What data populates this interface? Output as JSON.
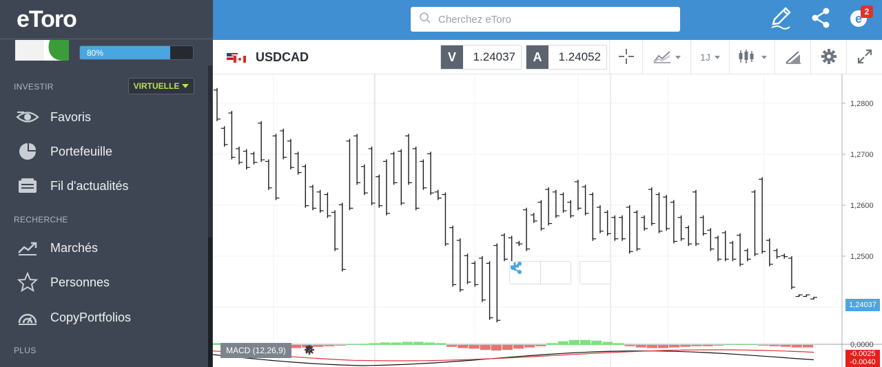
{
  "brand": {
    "logo_text": "eToro"
  },
  "profile": {
    "progress_label": "80%",
    "progress_value": 0.8
  },
  "sidebar": {
    "section_invest": "INVESTIR",
    "mode_label": "VIRTUELLE",
    "invest_items": [
      {
        "label": "Favoris",
        "icon": "eye-icon"
      },
      {
        "label": "Portefeuille",
        "icon": "pie-chart-icon"
      },
      {
        "label": "Fil d'actualités",
        "icon": "news-feed-icon"
      }
    ],
    "section_research": "RECHERCHE",
    "research_items": [
      {
        "label": "Marchés",
        "icon": "trend-chart-icon"
      },
      {
        "label": "Personnes",
        "icon": "star-icon"
      },
      {
        "label": "CopyPortfolios",
        "icon": "copyportfolio-icon"
      }
    ],
    "section_more": "PLUS"
  },
  "topbar": {
    "search_placeholder": "Cherchez eToro",
    "notification_count": "2"
  },
  "instrument": {
    "symbol": "USDCAD",
    "sell_tag": "V",
    "sell_price": "1.24037",
    "buy_tag": "A",
    "buy_price": "1.24052",
    "timeframe": "1J"
  },
  "chart_overlay": {
    "current_price_tag": "1,24037",
    "macd_label": "MACD (12,26,9)",
    "macd_value_tag": "-0.0025",
    "macd_value_tag2": "-0.0040"
  },
  "colors": {
    "sidebar_bg": "#3f4653",
    "topbar_bg": "#3f8fd2",
    "accent_blue": "#4aa6e0",
    "virtual_green": "#b8e05a",
    "macd_pos": "#7ee07e",
    "macd_neg": "#f07070"
  },
  "chart_data": {
    "type": "ohlc",
    "y_ticks": [
      "1,2800",
      "1,2700",
      "1,2600",
      "1,2500"
    ],
    "y_tick_values": [
      1.28,
      1.27,
      1.26,
      1.25
    ],
    "macd_tick": "0,0000",
    "ylim": [
      1.2425,
      1.2835
    ],
    "bars": [
      [
        1.283,
        1.2765
      ],
      [
        1.2755,
        1.2715
      ],
      [
        1.2785,
        1.269
      ],
      [
        1.2715,
        1.268
      ],
      [
        1.271,
        1.267
      ],
      [
        1.2705,
        1.268
      ],
      [
        1.2765,
        1.2685
      ],
      [
        1.269,
        1.263
      ],
      [
        1.274,
        1.261
      ],
      [
        1.275,
        1.269
      ],
      [
        1.273,
        1.267
      ],
      [
        1.2705,
        1.266
      ],
      [
        1.268,
        1.2595
      ],
      [
        1.264,
        1.259
      ],
      [
        1.263,
        1.2585
      ],
      [
        1.2625,
        1.2575
      ],
      [
        1.259,
        1.251
      ],
      [
        1.2605,
        1.247
      ],
      [
        1.273,
        1.259
      ],
      [
        1.274,
        1.264
      ],
      [
        1.268,
        1.262
      ],
      [
        1.2715,
        1.26
      ],
      [
        1.266,
        1.2595
      ],
      [
        1.269,
        1.258
      ],
      [
        1.2705,
        1.264
      ],
      [
        1.271,
        1.26
      ],
      [
        1.274,
        1.264
      ],
      [
        1.2715,
        1.259
      ],
      [
        1.269,
        1.263
      ],
      [
        1.2705,
        1.262
      ],
      [
        1.263,
        1.261
      ],
      [
        1.2625,
        1.252
      ],
      [
        1.256,
        1.244
      ],
      [
        1.2535,
        1.243
      ],
      [
        1.2505,
        1.2445
      ],
      [
        1.249,
        1.244
      ],
      [
        1.25,
        1.241
      ],
      [
        1.249,
        1.2375
      ],
      [
        1.2525,
        1.237
      ],
      [
        1.2545,
        1.249
      ],
      [
        1.254,
        1.248
      ],
      [
        1.253,
        1.252
      ],
      [
        1.2595,
        1.251
      ],
      [
        1.2585,
        1.2565
      ],
      [
        1.261,
        1.255
      ],
      [
        1.2635,
        1.256
      ],
      [
        1.263,
        1.2575
      ],
      [
        1.2625,
        1.2585
      ],
      [
        1.261,
        1.2575
      ],
      [
        1.265,
        1.259
      ],
      [
        1.264,
        1.258
      ],
      [
        1.2625,
        1.253
      ],
      [
        1.26,
        1.2545
      ],
      [
        1.259,
        1.254
      ],
      [
        1.258,
        1.253
      ],
      [
        1.258,
        1.253
      ],
      [
        1.26,
        1.2505
      ],
      [
        1.259,
        1.251
      ],
      [
        1.258,
        1.255
      ],
      [
        1.2635,
        1.256
      ],
      [
        1.2625,
        1.2545
      ],
      [
        1.262,
        1.255
      ],
      [
        1.261,
        1.2525
      ],
      [
        1.258,
        1.253
      ],
      [
        1.256,
        1.252
      ],
      [
        1.263,
        1.252
      ],
      [
        1.258,
        1.254
      ],
      [
        1.2555,
        1.251
      ],
      [
        1.254,
        1.249
      ],
      [
        1.255,
        1.249
      ],
      [
        1.253,
        1.249
      ],
      [
        1.2545,
        1.248
      ],
      [
        1.2515,
        1.249
      ],
      [
        1.263,
        1.25
      ],
      [
        1.2655,
        1.2505
      ],
      [
        1.2535,
        1.248
      ],
      [
        1.2515,
        1.2495
      ],
      [
        1.2505,
        1.2495
      ],
      [
        1.25,
        1.2435
      ],
      [
        1.2425,
        1.242
      ],
      [
        1.2425,
        1.242
      ],
      [
        1.242,
        1.2415
      ]
    ],
    "macd_hist": [
      0.3,
      0.2,
      0.1,
      -0.2,
      -0.4,
      -0.5,
      -0.6,
      -0.5,
      -0.4,
      -0.3,
      -0.2,
      -0.1,
      0.1,
      0.2,
      0.3,
      0.4,
      0.4,
      0.5,
      0.5,
      0.4,
      0.3,
      -0.3,
      -0.5,
      -0.6,
      -0.8,
      -0.9,
      -0.8,
      -0.6,
      -0.4,
      -0.2,
      0.3,
      0.6,
      0.8,
      0.8,
      0.7,
      0.5,
      0.3,
      -0.2,
      -0.4,
      -0.5,
      -0.5,
      -0.4,
      -0.3,
      -0.2,
      -0.2,
      -0.1,
      0.1,
      0.1,
      0.1,
      -0.1,
      -0.2,
      -0.3,
      -0.4,
      -0.4
    ]
  }
}
